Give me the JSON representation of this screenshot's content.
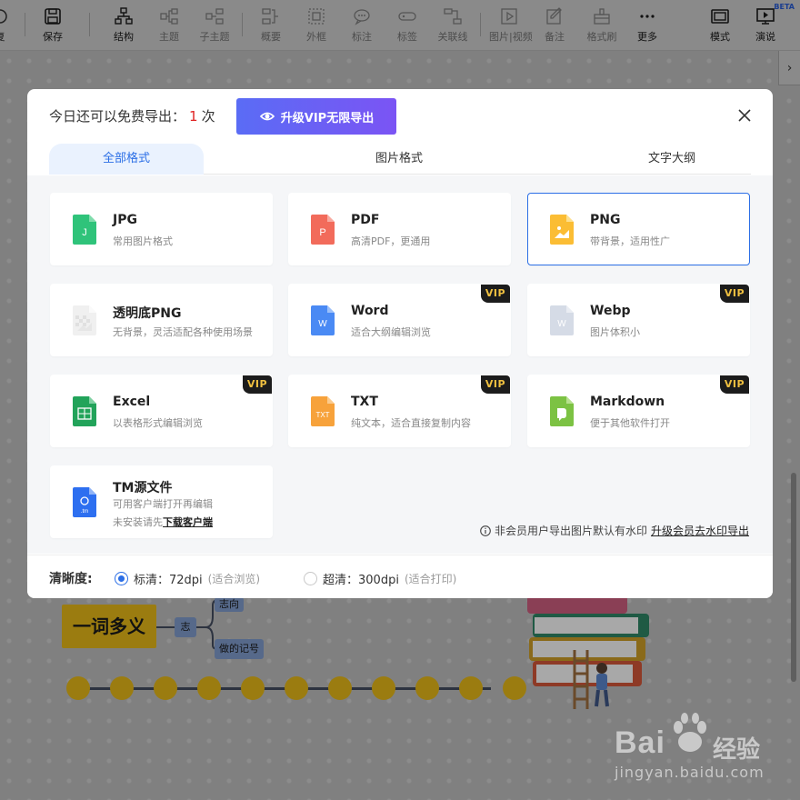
{
  "toolbar": {
    "items": [
      {
        "label": "复",
        "icon": "undo-icon"
      },
      {
        "label": "保存",
        "icon": "save-icon"
      },
      {
        "label": "结构",
        "icon": "structure-icon"
      },
      {
        "label": "主题",
        "icon": "topic-icon"
      },
      {
        "label": "子主题",
        "icon": "subtopic-icon"
      },
      {
        "label": "概要",
        "icon": "summary-icon"
      },
      {
        "label": "外框",
        "icon": "frame-icon"
      },
      {
        "label": "标注",
        "icon": "callout-icon"
      },
      {
        "label": "标签",
        "icon": "tag-icon"
      },
      {
        "label": "关联线",
        "icon": "relation-icon"
      },
      {
        "label": "图片|视频",
        "icon": "media-icon"
      },
      {
        "label": "备注",
        "icon": "note-icon"
      },
      {
        "label": "格式刷",
        "icon": "format-painter-icon"
      },
      {
        "label": "更多",
        "icon": "more-icon"
      },
      {
        "label": "模式",
        "icon": "mode-icon"
      },
      {
        "label": "演说",
        "icon": "present-icon"
      }
    ],
    "beta": "BETA"
  },
  "mindmap": {
    "main_topic": "一词多义",
    "sub_topic": "志",
    "branch_1": "志向",
    "branch_2": "做的记号"
  },
  "modal": {
    "quota_prefix": "今日还可以免费导出：",
    "quota_count": "1",
    "quota_suffix": "次",
    "vip_button": "升级VIP无限导出",
    "tabs": [
      "全部格式",
      "图片格式",
      "文字大纲"
    ],
    "formats": [
      {
        "name": "JPG",
        "desc": "常用图片格式",
        "vip": false,
        "icon": "jpg-file-icon",
        "color": "#2fc37a",
        "letter": "J"
      },
      {
        "name": "PDF",
        "desc": "高清PDF，更通用",
        "vip": false,
        "icon": "pdf-file-icon",
        "color": "#f26b5b",
        "letter": "P"
      },
      {
        "name": "PNG",
        "desc": "带背景，适用性广",
        "vip": false,
        "icon": "png-file-icon",
        "color": "#fbbd34",
        "letter": ""
      },
      {
        "name": "透明底PNG",
        "desc": "无背景，灵活适配各种使用场景",
        "vip": false,
        "icon": "transparent-png-file-icon",
        "color": "#e8e8e8",
        "letter": ""
      },
      {
        "name": "Word",
        "desc": "适合大纲编辑浏览",
        "vip": true,
        "icon": "word-file-icon",
        "color": "#4a8af4",
        "letter": "W"
      },
      {
        "name": "Webp",
        "desc": "图片体积小",
        "vip": true,
        "icon": "webp-file-icon",
        "color": "#d5dbe6",
        "letter": "W"
      },
      {
        "name": "Excel",
        "desc": "以表格形式编辑浏览",
        "vip": true,
        "icon": "excel-file-icon",
        "color": "#22a35a",
        "letter": "X"
      },
      {
        "name": "TXT",
        "desc": "纯文本，适合直接复制内容",
        "vip": true,
        "icon": "txt-file-icon",
        "color": "#f7a23b",
        "letter": "TXT"
      },
      {
        "name": "Markdown",
        "desc": "便于其他软件打开",
        "vip": true,
        "icon": "markdown-file-icon",
        "color": "#7cc243",
        "letter": ""
      },
      {
        "name": "TM源文件",
        "desc": "可用客户端打开再编辑",
        "desc_line2_prefix": "未安装请先",
        "desc_link": "下载客户端",
        "vip": false,
        "icon": "tm-file-icon",
        "color": "#2d6ff0",
        "letter": ".tm"
      }
    ],
    "vip_label": "VIP",
    "notice_text": "非会员用户导出图片默认有水印",
    "notice_link": "升级会员去水印导出",
    "quality_label": "清晰度:",
    "quality_options": [
      {
        "label": "标清：72dpi",
        "hint": "(适合浏览)",
        "selected": true
      },
      {
        "label": "超清：300dpi",
        "hint": "(适合打印)",
        "selected": false
      }
    ]
  },
  "watermark": {
    "brand": "Bai",
    "brand_tail": "经验",
    "url": "jingyan.baidu.com"
  }
}
